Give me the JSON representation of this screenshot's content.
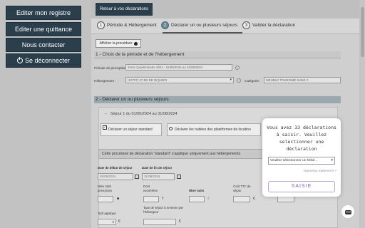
{
  "sidebar": {
    "items": [
      {
        "label": "Editer mon registre"
      },
      {
        "label": "Editer une quittance"
      },
      {
        "label": "Nous contacter"
      },
      {
        "label": "Se déconnecter",
        "icon": "power-icon"
      }
    ]
  },
  "header": {
    "back_label": "Retour à vos déclarations"
  },
  "stepper": {
    "steps": [
      {
        "num": "1",
        "label": "Période & Hébergement"
      },
      {
        "num": "2",
        "label": "Déclarer un ou plusieurs séjours"
      },
      {
        "num": "3",
        "label": "Valider la déclaration"
      }
    ]
  },
  "procedure_btn": "Afficher la procédure",
  "section1": {
    "title": "1 - Choix de la période et de l'hébergement",
    "period_label": "Période de perception:",
    "period_value": "2ème Quadrimestre 2024 - 01/05/2024 au 31/08/2024",
    "lodging_label": "Hébergement :",
    "lodging_value": "(10707) 37 BD DE RIQUIER",
    "category_label": "Catégorie:",
    "category_value": "MEUBLE TOURISME SANS C"
  },
  "section2": {
    "title": "2 - Déclarer un ou plusieurs séjours",
    "stay_title": "Séjour 1 du 01/05/2024 au 31/08/2024",
    "stay_toggle": "−",
    "option_standard": "Déclarer un séjour standard",
    "option_platform": "Déclarer les nuitées des plateformes de location",
    "procedure_note": "Cette procédure de déclaration \"standard\" s'applique uniquement aux hébergements",
    "start_label": "Date de début de séjour",
    "start_value": "01/05/2024",
    "end_label": "Date de fin de séjour",
    "end_value": "31/08/2024",
    "persons_label": "Nbre total personnes",
    "persons_value": "",
    "exempt_label": "Dont exonérées",
    "exempt_value": "",
    "nights_label": "Nbre nuits",
    "nights_value": "",
    "cost_label": "Coût TTC du séjour",
    "cost_value": "",
    "tariff_label": "Tarif appliqué",
    "tariff_value": "0",
    "tax_label": "Taxe de séjour à reverser par l'hébergeur",
    "tax_value": "",
    "currency": "€"
  },
  "popup": {
    "message": "Vous avez 33 déclarations à saisir. Veuillez selectionner une déclaration",
    "select_placeholder": "Veuillez sélectionner un hébé...",
    "link": "Nouveau traitement ?",
    "button": "SAISIE"
  },
  "colors": {
    "sidebar_button": "#2a3e4c",
    "accent": "#7e68b0",
    "section2_header": "#9aa9b0"
  }
}
